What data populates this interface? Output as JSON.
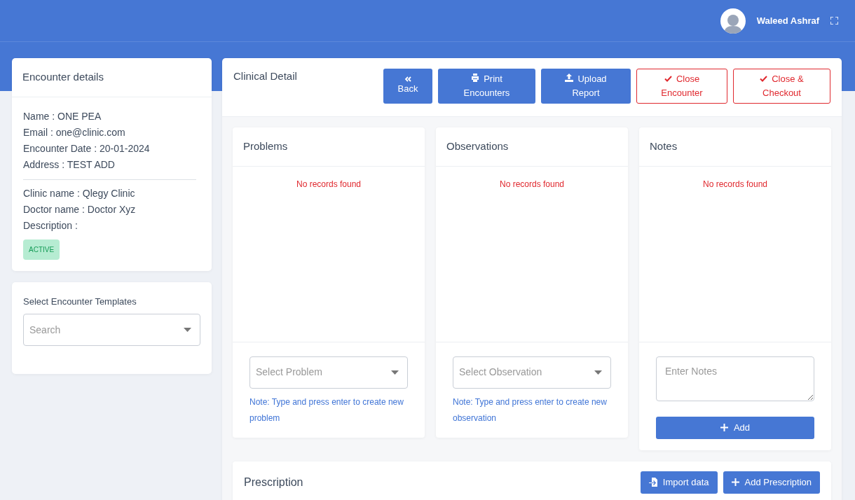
{
  "header": {
    "user_name": "Waleed Ashraf"
  },
  "encounter": {
    "title": "Encounter details",
    "patient_lines": [
      "Name : ONE PEA",
      "Email : one@clinic.com",
      "Encounter Date : 20-01-2024",
      "Address : TEST ADD"
    ],
    "clinic_lines": [
      "Clinic name : Qlegy Clinic",
      "Doctor name : Doctor Xyz",
      "Description :"
    ],
    "status": "ACTIVE"
  },
  "templates": {
    "label": "Select Encounter Templates",
    "placeholder": "Search"
  },
  "clinical": {
    "title": "Clinical Detail",
    "buttons": [
      {
        "label": "Back",
        "kind": "back"
      },
      {
        "label": "Print Encounters",
        "kind": "print"
      },
      {
        "label": "Upload Report",
        "kind": "upload"
      },
      {
        "label": "Close Encounter",
        "kind": "close"
      },
      {
        "label": "Close & Checkout",
        "kind": "close"
      }
    ]
  },
  "panels": [
    {
      "title": "Problems",
      "empty_text": "No records found",
      "kind": "select",
      "placeholder": "Select Problem",
      "note": "Note: Type and press enter to create new problem"
    },
    {
      "title": "Observations",
      "empty_text": "No records found",
      "kind": "select",
      "placeholder": "Select Observation",
      "note": "Note: Type and press enter to create new observation"
    },
    {
      "title": "Notes",
      "empty_text": "No records found",
      "kind": "textarea",
      "placeholder": "Enter Notes",
      "button": "Add"
    }
  ],
  "prescription": {
    "title": "Prescription",
    "buttons": [
      {
        "label": "Import data",
        "kind": "import"
      },
      {
        "label": "Add Prescription",
        "kind": "add"
      }
    ]
  }
}
